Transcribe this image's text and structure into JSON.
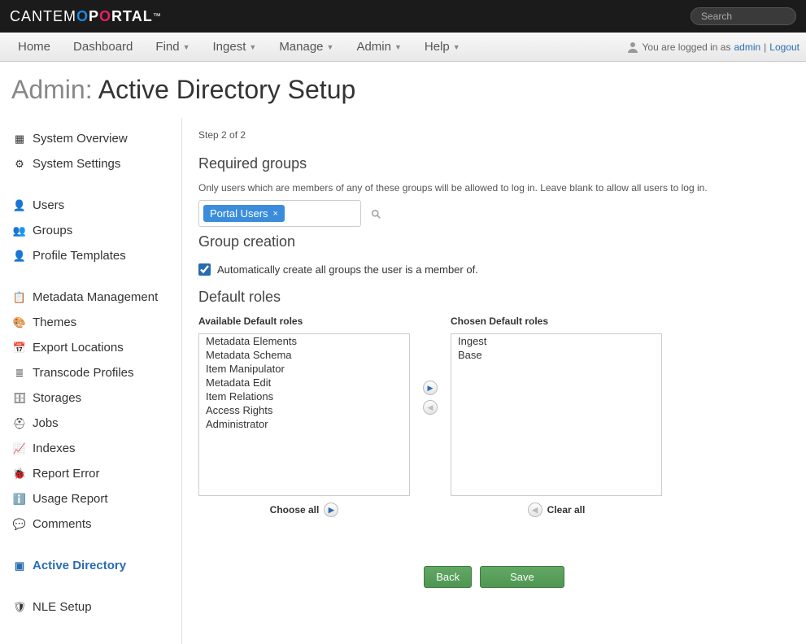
{
  "topbar": {
    "logo_text": "CANTEMO PORTAL",
    "search_placeholder": "Search"
  },
  "nav": {
    "items": [
      "Home",
      "Dashboard",
      "Find",
      "Ingest",
      "Manage",
      "Admin",
      "Help"
    ],
    "dropdown": [
      false,
      false,
      true,
      true,
      true,
      true,
      true
    ],
    "login_prefix": "You are logged in as",
    "username": "admin",
    "sep": "|",
    "logout": "Logout"
  },
  "title": {
    "admin": "Admin",
    "sep": ":",
    "page": "Active Directory Setup"
  },
  "sidebar": {
    "groups": [
      {
        "items": [
          {
            "label": "System Overview",
            "icon": "grid",
            "active": false
          },
          {
            "label": "System Settings",
            "icon": "gear",
            "active": false
          }
        ]
      },
      {
        "items": [
          {
            "label": "Users",
            "icon": "user",
            "active": false
          },
          {
            "label": "Groups",
            "icon": "users",
            "active": false
          },
          {
            "label": "Profile Templates",
            "icon": "profile",
            "active": false
          }
        ]
      },
      {
        "items": [
          {
            "label": "Metadata Management",
            "icon": "list",
            "active": false
          },
          {
            "label": "Themes",
            "icon": "palette",
            "active": false
          },
          {
            "label": "Export Locations",
            "icon": "calendar",
            "active": false
          },
          {
            "label": "Transcode Profiles",
            "icon": "stack",
            "active": false
          },
          {
            "label": "Storages",
            "icon": "db",
            "active": false
          },
          {
            "label": "Jobs",
            "icon": "hat",
            "active": false
          },
          {
            "label": "Indexes",
            "icon": "chart",
            "active": false
          },
          {
            "label": "Report Error",
            "icon": "bug",
            "active": false
          },
          {
            "label": "Usage Report",
            "icon": "info",
            "active": false
          },
          {
            "label": "Comments",
            "icon": "comment",
            "active": false
          }
        ]
      },
      {
        "items": [
          {
            "label": "Active Directory",
            "icon": "window",
            "active": true
          }
        ]
      },
      {
        "items": [
          {
            "label": "NLE Setup",
            "icon": "shield",
            "active": false
          }
        ]
      }
    ]
  },
  "main": {
    "step": "Step 2 of 2",
    "required_groups_heading": "Required groups",
    "required_groups_help": "Only users which are members of any of these groups will be allowed to log in. Leave blank to allow all users to log in.",
    "tag": "Portal Users",
    "group_creation_heading": "Group creation",
    "auto_create_label": "Automatically create all groups the user is a member of.",
    "auto_create_checked": true,
    "default_roles_heading": "Default roles",
    "available_label": "Available Default roles",
    "chosen_label": "Chosen Default roles",
    "available_roles": [
      "Metadata Elements",
      "Metadata Schema",
      "Item Manipulator",
      "Metadata Edit",
      "Item Relations",
      "Access Rights",
      "Administrator"
    ],
    "chosen_roles": [
      "Ingest",
      "Base"
    ],
    "choose_all": "Choose all",
    "clear_all": "Clear all",
    "back": "Back",
    "save": "Save"
  }
}
